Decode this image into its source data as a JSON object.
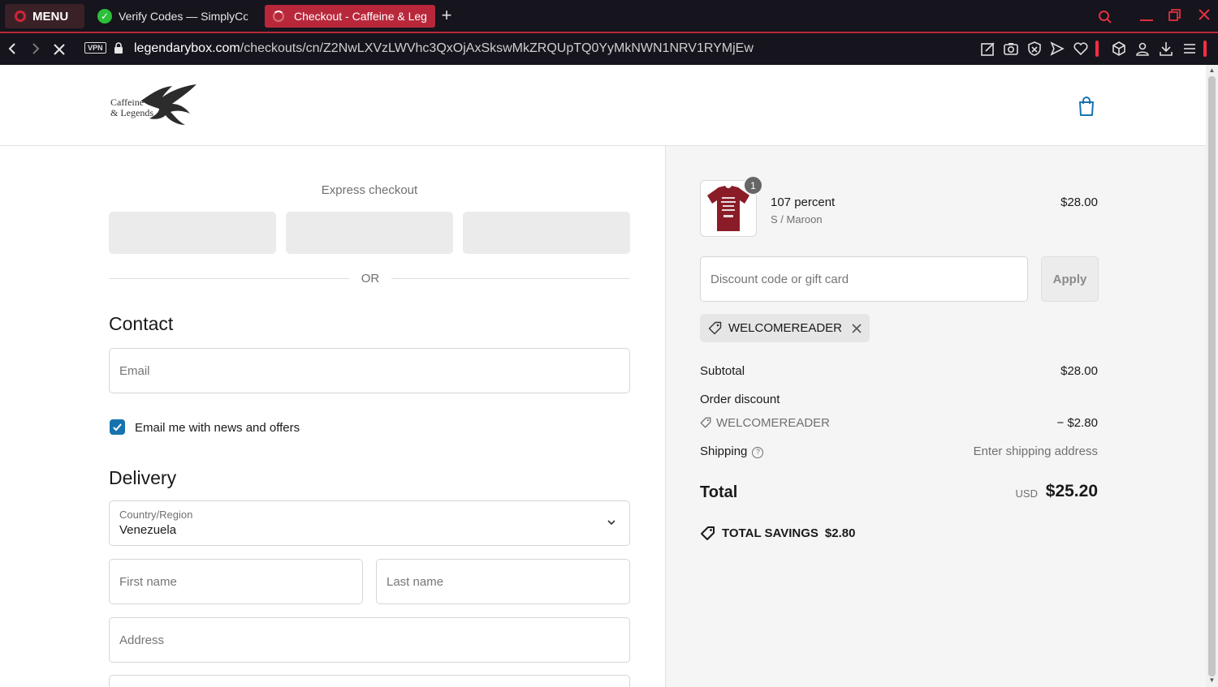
{
  "browser": {
    "menu_label": "MENU",
    "tabs": [
      {
        "title": "Verify Codes — SimplyCod"
      },
      {
        "title": "Checkout - Caffeine & Leg"
      }
    ],
    "new_tab_label": "+",
    "vpn_label": "VPN",
    "url_domain": "legendarybox.com",
    "url_path": "/checkouts/cn/Z2NwLXVzLWVhc3QxOjAxSkswMkZRQUpTQ0YyMkNWN1NRV1RYMjEw",
    "colors": {
      "accent": "#b8283a",
      "chrome_bg": "#16141c"
    }
  },
  "store": {
    "logo_text_line1": "Caffeine",
    "logo_text_line2": "& Legends"
  },
  "express": {
    "title": "Express checkout",
    "or_label": "OR"
  },
  "contact": {
    "title": "Contact",
    "email_placeholder": "Email",
    "marketing_label": "Email me with news and offers",
    "marketing_checked": true
  },
  "delivery": {
    "title": "Delivery",
    "country_label": "Country/Region",
    "country_value": "Venezuela",
    "first_name_placeholder": "First name",
    "last_name_placeholder": "Last name",
    "address_placeholder": "Address"
  },
  "order": {
    "item": {
      "quantity": "1",
      "name": "107 percent",
      "variant": "S / Maroon",
      "price": "$28.00"
    },
    "discount_placeholder": "Discount code or gift card",
    "apply_label": "Apply",
    "applied_code": "WELCOMEREADER",
    "subtotal_label": "Subtotal",
    "subtotal_value": "$28.00",
    "order_discount_label": "Order discount",
    "discount_code": "WELCOMEREADER",
    "discount_value": "− $2.80",
    "shipping_label": "Shipping",
    "shipping_value": "Enter shipping address",
    "total_label": "Total",
    "total_currency": "USD",
    "total_value": "$25.20",
    "savings_label": "TOTAL SAVINGS",
    "savings_value": "$2.80"
  }
}
